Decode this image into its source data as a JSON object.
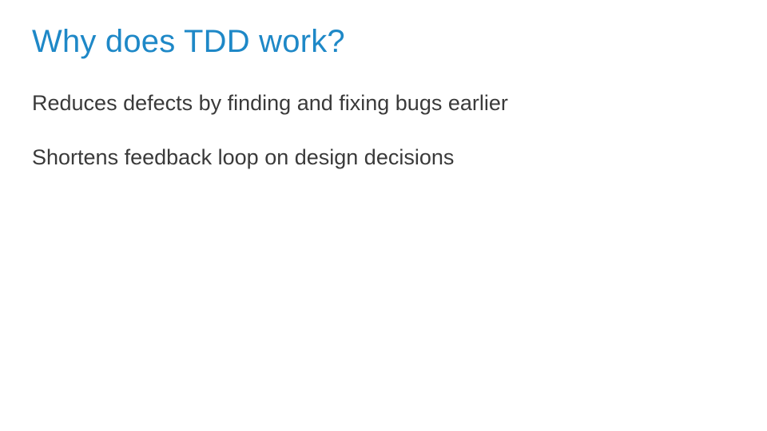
{
  "slide": {
    "title": "Why does TDD work?",
    "points": [
      "Reduces defects by finding and fixing bugs earlier",
      "Shortens feedback loop on design decisions"
    ]
  },
  "colors": {
    "title": "#1e88c7",
    "body": "#3a3a3a",
    "background": "#ffffff"
  }
}
